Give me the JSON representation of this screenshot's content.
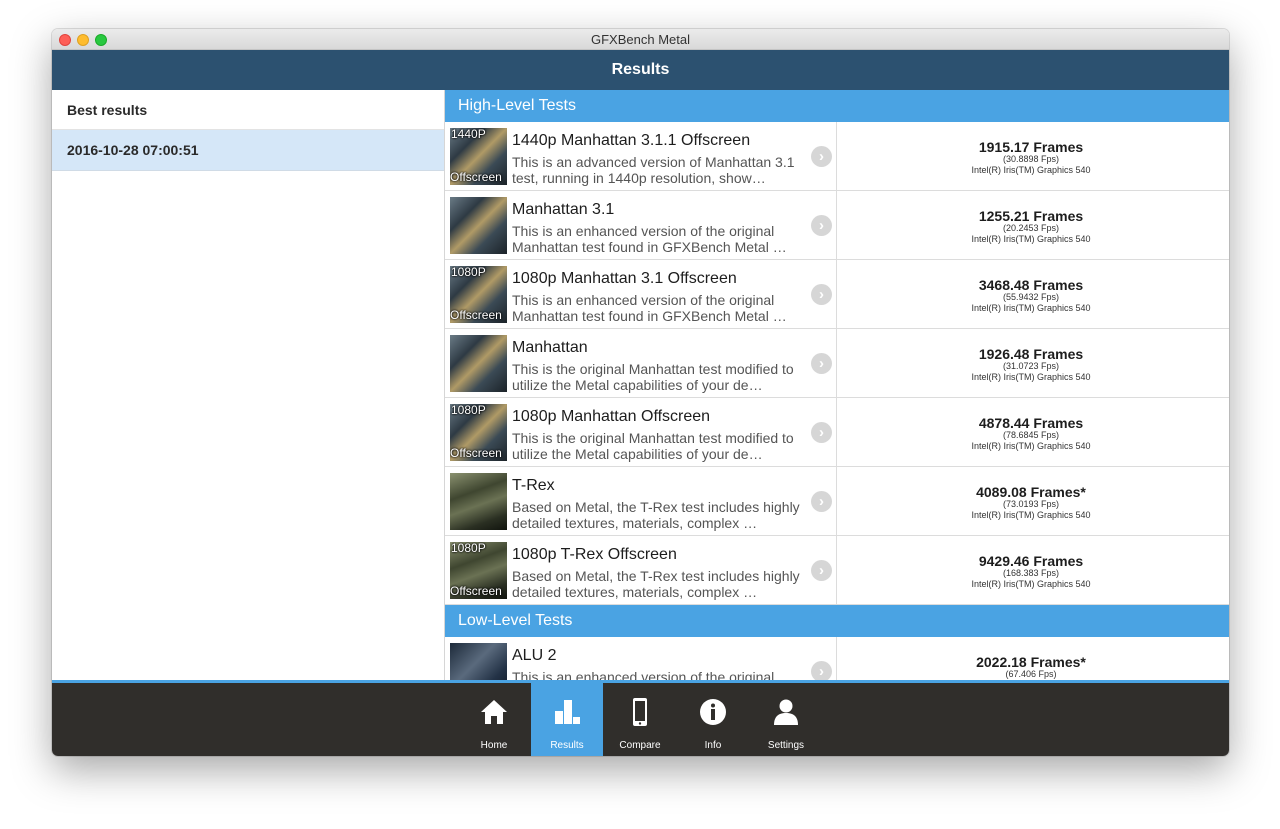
{
  "window": {
    "title": "GFXBench Metal"
  },
  "navbar": {
    "title": "Results"
  },
  "sidebar": {
    "header": "Best results",
    "items": [
      {
        "label": "2016-10-28 07:00:51"
      }
    ]
  },
  "sections": [
    {
      "title": "High-Level Tests",
      "rows": [
        {
          "title": "1440p Manhattan 3.1.1 Offscreen",
          "desc": "This is an advanced version of Manhattan 3.1 test, running in 1440p resolution, show…",
          "overlay_top": "1440P",
          "overlay_bottom": "Offscreen",
          "thumb_icon": "manhattan-thumbnail",
          "score": "1915.17 Frames",
          "fps": "(30.8898 Fps)",
          "device": "Intel(R) Iris(TM) Graphics 540"
        },
        {
          "title": "Manhattan 3.1",
          "desc": "This is an enhanced version of the original Manhattan test found in GFXBench Metal …",
          "overlay_top": "",
          "overlay_bottom": "",
          "thumb_icon": "manhattan-thumbnail",
          "score": "1255.21 Frames",
          "fps": "(20.2453 Fps)",
          "device": "Intel(R) Iris(TM) Graphics 540"
        },
        {
          "title": "1080p Manhattan 3.1 Offscreen",
          "desc": "This is an enhanced version of the original Manhattan test found in GFXBench Metal …",
          "overlay_top": "1080P",
          "overlay_bottom": "Offscreen",
          "thumb_icon": "manhattan-thumbnail",
          "score": "3468.48 Frames",
          "fps": "(55.9432 Fps)",
          "device": "Intel(R) Iris(TM) Graphics 540"
        },
        {
          "title": "Manhattan",
          "desc": "This is the original Manhattan test modified to utilize the Metal capabilities of your de…",
          "overlay_top": "",
          "overlay_bottom": "",
          "thumb_icon": "manhattan-thumbnail",
          "score": "1926.48 Frames",
          "fps": "(31.0723 Fps)",
          "device": "Intel(R) Iris(TM) Graphics 540"
        },
        {
          "title": "1080p Manhattan Offscreen",
          "desc": "This is the original Manhattan test modified to utilize the Metal capabilities of your de…",
          "overlay_top": "1080P",
          "overlay_bottom": "Offscreen",
          "thumb_icon": "manhattan-thumbnail",
          "score": "4878.44 Frames",
          "fps": "(78.6845 Fps)",
          "device": "Intel(R) Iris(TM) Graphics 540"
        },
        {
          "title": "T-Rex",
          "desc": "Based on Metal, the T-Rex test includes highly detailed textures, materials, complex …",
          "overlay_top": "",
          "overlay_bottom": "",
          "thumb_icon": "trex-thumbnail",
          "score": "4089.08 Frames*",
          "fps": "(73.0193 Fps)",
          "device": "Intel(R) Iris(TM) Graphics 540"
        },
        {
          "title": "1080p T-Rex Offscreen",
          "desc": "Based on Metal, the T-Rex test includes highly detailed textures, materials, complex …",
          "overlay_top": "1080P",
          "overlay_bottom": "Offscreen",
          "thumb_icon": "trex-thumbnail",
          "score": "9429.46 Frames",
          "fps": "(168.383 Fps)",
          "device": "Intel(R) Iris(TM) Graphics 540"
        }
      ]
    },
    {
      "title": "Low-Level Tests",
      "rows": [
        {
          "title": "ALU 2",
          "desc": "This is an enhanced version of the original ALU …",
          "overlay_top": "",
          "overlay_bottom": "",
          "thumb_icon": "alu-thumbnail",
          "score": "2022.18 Frames*",
          "fps": "(67.406 Fps)",
          "device": ""
        }
      ]
    }
  ],
  "tabbar": {
    "tabs": [
      {
        "label": "Home",
        "icon": "home-icon"
      },
      {
        "label": "Results",
        "icon": "bar-chart-icon"
      },
      {
        "label": "Compare",
        "icon": "phone-icon"
      },
      {
        "label": "Info",
        "icon": "info-icon"
      },
      {
        "label": "Settings",
        "icon": "user-icon"
      }
    ],
    "active": "Results"
  },
  "colors": {
    "navbar": "#2c5170",
    "section_header": "#4aa3e3",
    "selected_row": "#d5e7f8",
    "tabbar": "#302e2b",
    "tab_active": "#4aa3e3"
  }
}
